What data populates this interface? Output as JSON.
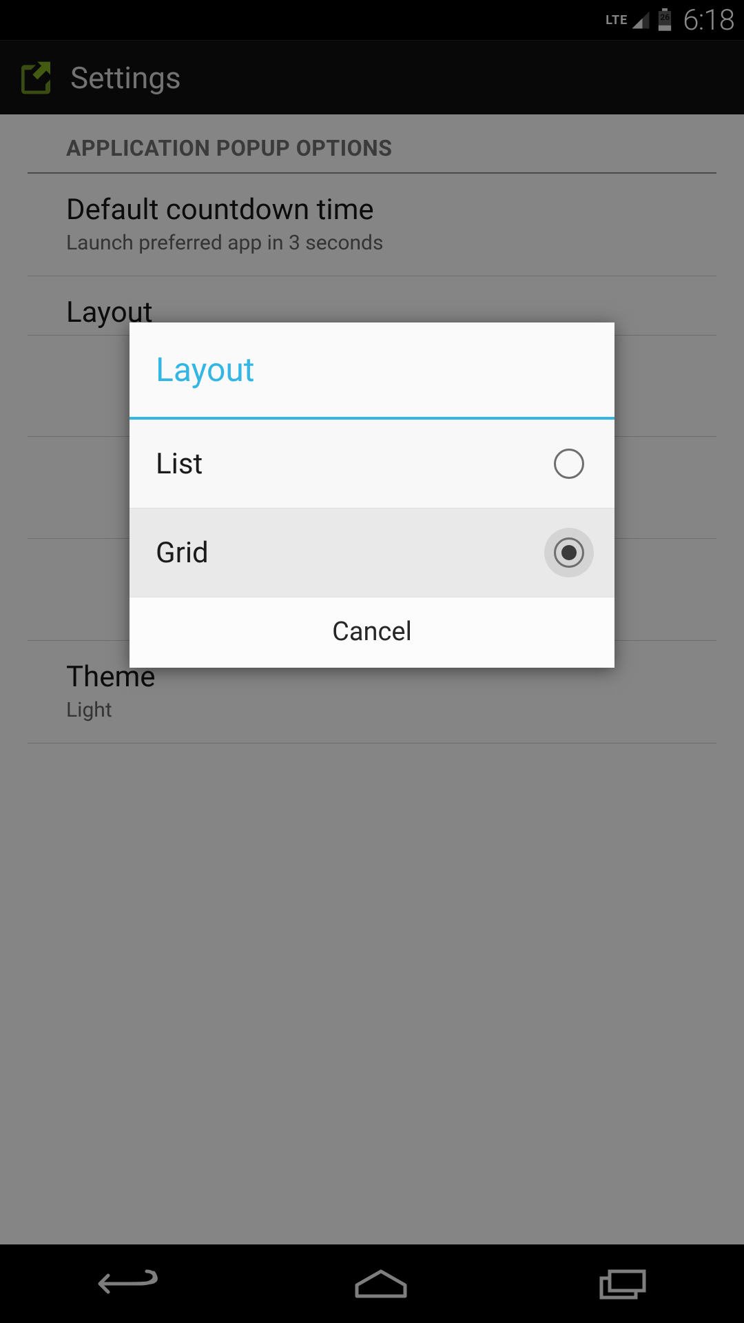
{
  "statusbar": {
    "network_label": "LTE",
    "battery_pct": "26",
    "clock": "6:18"
  },
  "actionbar": {
    "title": "Settings"
  },
  "section_header": "APPLICATION POPUP OPTIONS",
  "prefs": {
    "countdown": {
      "title": "Default countdown time",
      "summary": "Launch preferred app in 3 seconds"
    },
    "layout": {
      "title": "Layout"
    },
    "theme": {
      "title": "Theme",
      "summary": "Light"
    }
  },
  "dialog": {
    "title": "Layout",
    "options": [
      {
        "label": "List",
        "selected": false
      },
      {
        "label": "Grid",
        "selected": true
      }
    ],
    "cancel": "Cancel"
  }
}
